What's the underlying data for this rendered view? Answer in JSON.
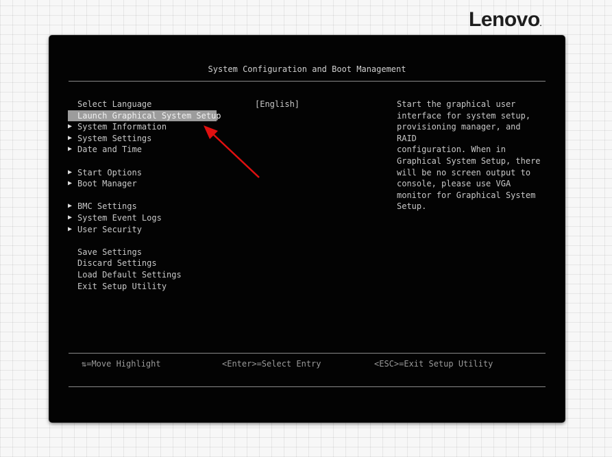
{
  "brand": {
    "logo_text": "Lenovo",
    "logo_dot": "."
  },
  "header": {
    "title": "System Configuration and Boot Management"
  },
  "menu": {
    "items": [
      {
        "label": "Select Language",
        "arrow": false
      },
      {
        "label": "Launch Graphical System Setup",
        "arrow": false,
        "selected": true
      },
      {
        "label": "System Information",
        "arrow": true
      },
      {
        "label": "System Settings",
        "arrow": true
      },
      {
        "label": "Date and Time",
        "arrow": true
      },
      {
        "label": "Start Options",
        "arrow": true
      },
      {
        "label": "Boot Manager",
        "arrow": true
      },
      {
        "label": "BMC Settings",
        "arrow": true
      },
      {
        "label": "System Event Logs",
        "arrow": true
      },
      {
        "label": "User Security",
        "arrow": true
      },
      {
        "label": "Save Settings",
        "arrow": false
      },
      {
        "label": "Discard Settings",
        "arrow": false
      },
      {
        "label": "Load Default Settings",
        "arrow": false
      },
      {
        "label": "Exit Setup Utility",
        "arrow": false
      }
    ],
    "arrow_glyph": "▶"
  },
  "language": {
    "value": "[English]"
  },
  "help": {
    "text": "Start the graphical user\ninterface for system setup,\nprovisioning manager, and RAID\nconfiguration. When in\nGraphical System Setup, there\nwill be no screen output to\nconsole, please use VGA\nmonitor for Graphical System\nSetup."
  },
  "footer": {
    "move": "⇅=Move Highlight",
    "select": "<Enter>=Select Entry",
    "exit": "<ESC>=Exit Setup Utility"
  },
  "colors": {
    "screen_bg": "#030303",
    "highlight": "#9c9c9c",
    "annotation_arrow": "#e01010",
    "text": "#c8c8c8"
  }
}
